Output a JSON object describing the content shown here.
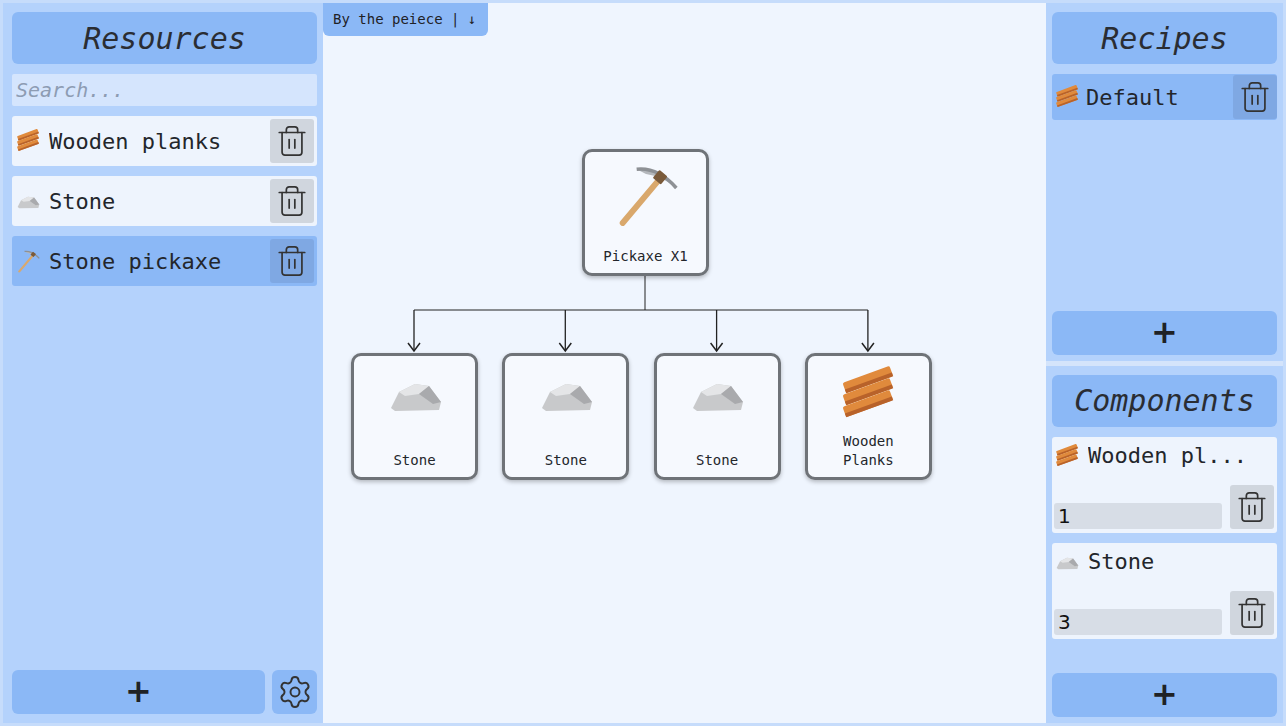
{
  "resources": {
    "title": "Resources",
    "search": {
      "placeholder": "Search..."
    },
    "items": [
      {
        "name": "Wooden planks",
        "kind": "planks",
        "selected": false
      },
      {
        "name": "Stone",
        "kind": "stone",
        "selected": false
      },
      {
        "name": "Stone pickaxe",
        "kind": "pickaxe",
        "selected": true
      }
    ],
    "add_button": "+"
  },
  "view_select": {
    "label": "By the peiece |",
    "arrow": "↓"
  },
  "tree": {
    "root": {
      "label": "Pickaxe X1",
      "kind": "pickaxe"
    },
    "children": [
      {
        "label": "Stone",
        "kind": "stone"
      },
      {
        "label": "Stone",
        "kind": "stone"
      },
      {
        "label": "Stone",
        "kind": "stone"
      },
      {
        "label": "Wooden Planks",
        "kind": "planks"
      }
    ]
  },
  "recipes": {
    "title": "Recipes",
    "items": [
      {
        "name": "Default",
        "kind": "planks",
        "selected": true
      }
    ],
    "add_button": "+"
  },
  "components": {
    "title": "Components",
    "items": [
      {
        "name": "Wooden pl...",
        "kind": "planks",
        "amount": "1"
      },
      {
        "name": "Stone",
        "kind": "stone",
        "amount": "3"
      }
    ],
    "add_button": "+"
  }
}
